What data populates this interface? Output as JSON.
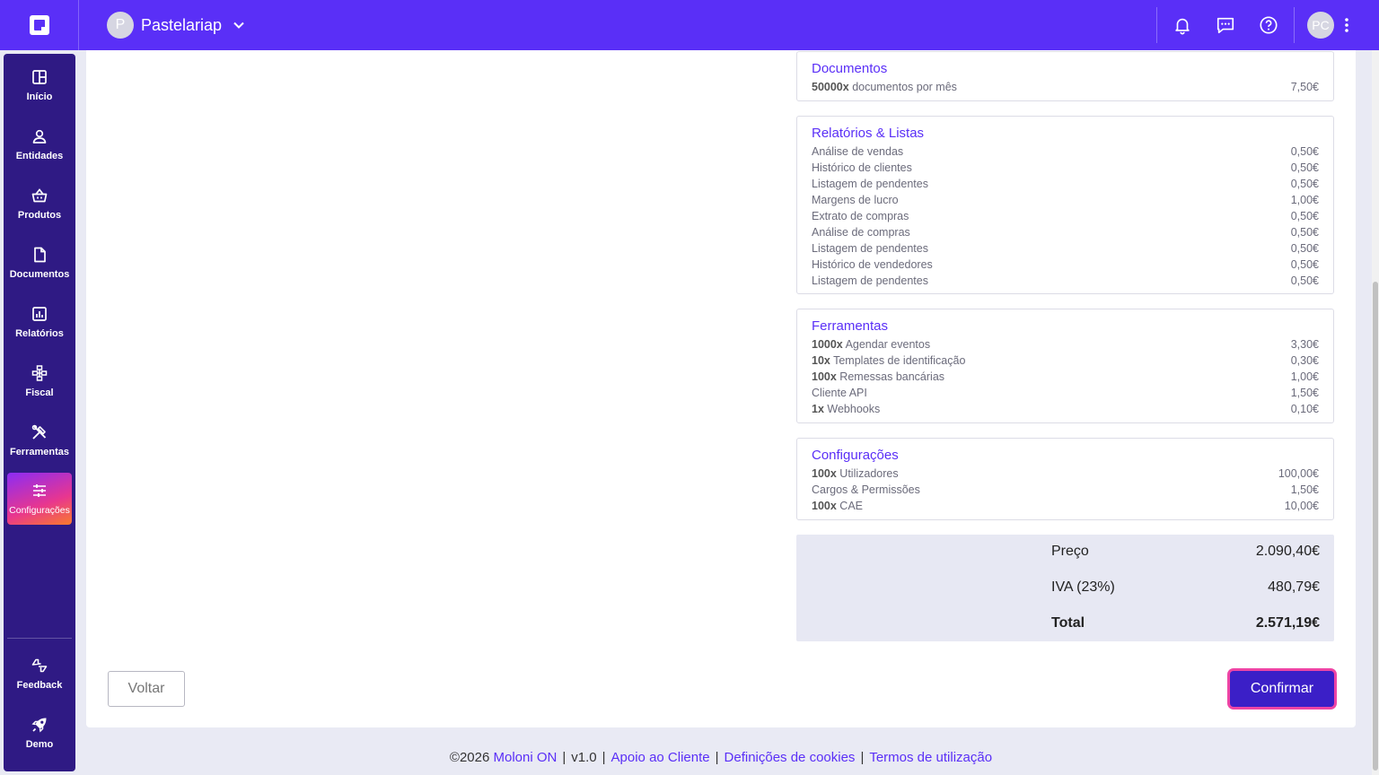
{
  "header": {
    "company_initial": "P",
    "company_name": "Pastelariap",
    "user_initials": "PC"
  },
  "sidebar": {
    "items": [
      {
        "label": "Início",
        "icon": "layout-icon"
      },
      {
        "label": "Entidades",
        "icon": "user-icon"
      },
      {
        "label": "Produtos",
        "icon": "basket-icon"
      },
      {
        "label": "Documentos",
        "icon": "document-icon"
      },
      {
        "label": "Relatórios",
        "icon": "chart-icon"
      },
      {
        "label": "Fiscal",
        "icon": "hierarchy-icon"
      },
      {
        "label": "Ferramentas",
        "icon": "tools-icon"
      },
      {
        "label": "Configurações",
        "icon": "sliders-icon",
        "active": true
      }
    ],
    "bottom": [
      {
        "label": "Feedback",
        "icon": "feedback-icon"
      },
      {
        "label": "Demo",
        "icon": "rocket-icon"
      }
    ]
  },
  "sections": {
    "documentos": {
      "title": "Documentos",
      "rows": [
        {
          "qty": "50000x",
          "label": "documentos por mês",
          "price": "7,50€"
        }
      ]
    },
    "relatorios": {
      "title": "Relatórios & Listas",
      "rows": [
        {
          "label": "Análise de vendas",
          "price": "0,50€"
        },
        {
          "label": "Histórico de clientes",
          "price": "0,50€"
        },
        {
          "label": "Listagem de pendentes",
          "price": "0,50€"
        },
        {
          "label": "Margens de lucro",
          "price": "1,00€"
        },
        {
          "label": "Extrato de compras",
          "price": "0,50€"
        },
        {
          "label": "Análise de compras",
          "price": "0,50€"
        },
        {
          "label": "Listagem de pendentes",
          "price": "0,50€"
        },
        {
          "label": "Histórico de vendedores",
          "price": "0,50€"
        },
        {
          "label": "Listagem de pendentes",
          "price": "0,50€"
        }
      ]
    },
    "ferramentas": {
      "title": "Ferramentas",
      "rows": [
        {
          "qty": "1000x",
          "label": "Agendar eventos",
          "price": "3,30€"
        },
        {
          "qty": "10x",
          "label": "Templates de identificação",
          "price": "0,30€"
        },
        {
          "qty": "100x",
          "label": "Remessas bancárias",
          "price": "1,00€"
        },
        {
          "label": "Cliente API",
          "price": "1,50€"
        },
        {
          "qty": "1x",
          "label": "Webhooks",
          "price": "0,10€"
        }
      ]
    },
    "configuracoes": {
      "title": "Configurações",
      "rows": [
        {
          "qty": "100x",
          "label": "Utilizadores",
          "price": "100,00€"
        },
        {
          "label": "Cargos & Permissões",
          "price": "1,50€"
        },
        {
          "qty": "100x",
          "label": "CAE",
          "price": "10,00€"
        }
      ]
    }
  },
  "totals": {
    "price_label": "Preço",
    "price_value": "2.090,40€",
    "vat_label": "IVA (23%)",
    "vat_value": "480,79€",
    "total_label": "Total",
    "total_value": "2.571,19€"
  },
  "actions": {
    "back_label": "Voltar",
    "confirm_label": "Confirmar"
  },
  "footer": {
    "copyright": "©2026",
    "brand": "Moloni ON",
    "version": "v1.0",
    "support": "Apoio ao Cliente",
    "cookies": "Definições de cookies",
    "terms": "Termos de utilização"
  },
  "colors": {
    "topbar": "#5a2ff7",
    "sidebar": "#2f1a84",
    "accent": "#5a2ff7",
    "confirm": "#3b1fc7",
    "confirm_ring": "#ee44a5"
  }
}
